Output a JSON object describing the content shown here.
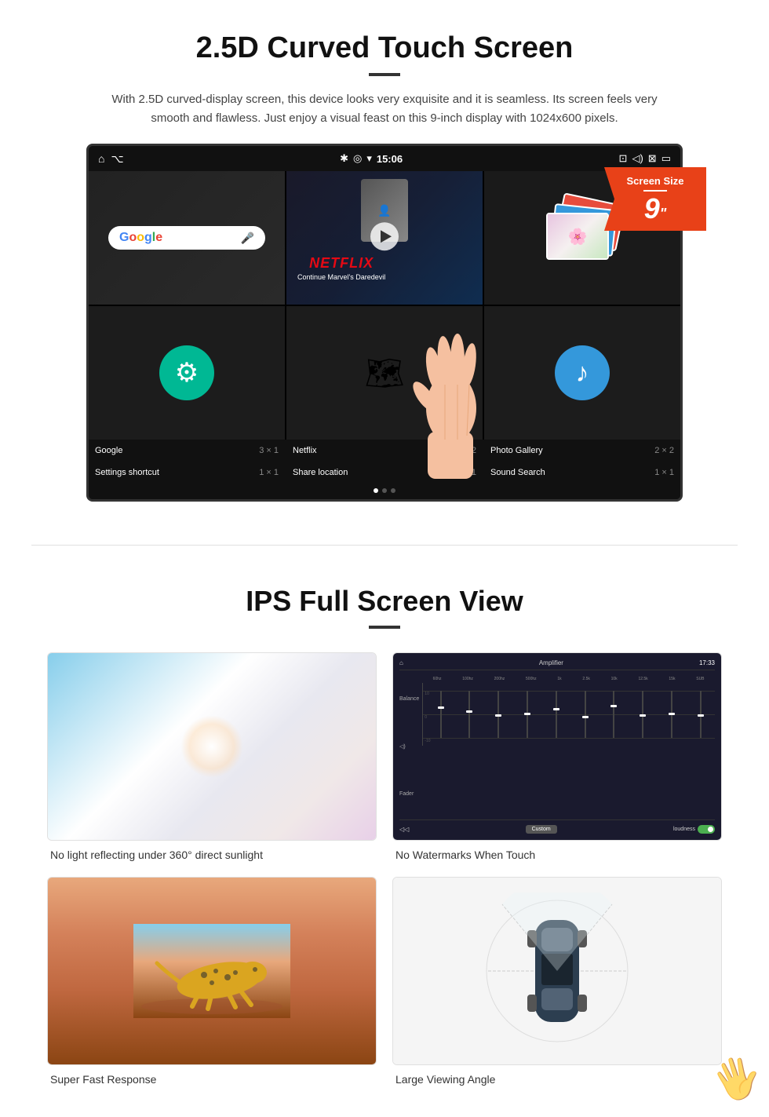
{
  "section1": {
    "title": "2.5D Curved Touch Screen",
    "description": "With 2.5D curved-display screen, this device looks very exquisite and it is seamless. Its screen feels very smooth and flawless. Just enjoy a visual feast on this 9-inch display with 1024x600 pixels.",
    "badge": {
      "label": "Screen Size",
      "size": "9",
      "inch": "\""
    },
    "status_bar": {
      "time": "15:06",
      "icons_left": [
        "home",
        "usb"
      ],
      "icons_right": [
        "bluetooth",
        "location",
        "wifi",
        "camera",
        "volume",
        "close",
        "screen"
      ]
    },
    "apps": [
      {
        "name": "Google",
        "size": "3 × 1"
      },
      {
        "name": "Netflix",
        "size": "3 × 2"
      },
      {
        "name": "Photo Gallery",
        "size": "2 × 2"
      },
      {
        "name": "Settings shortcut",
        "size": "1 × 1"
      },
      {
        "name": "Share location",
        "size": "1 × 1"
      },
      {
        "name": "Sound Search",
        "size": "1 × 1"
      }
    ],
    "netflix_text": "NETFLIX",
    "netflix_subtitle": "Continue Marvel's Daredevil"
  },
  "section2": {
    "title": "IPS Full Screen View",
    "features": [
      {
        "label": "No light reflecting under 360° direct sunlight",
        "image_type": "sky"
      },
      {
        "label": "No Watermarks When Touch",
        "image_type": "amplifier"
      },
      {
        "label": "Super Fast Response",
        "image_type": "cheetah"
      },
      {
        "label": "Large Viewing Angle",
        "image_type": "car"
      }
    ],
    "amplifier": {
      "title": "Amplifier",
      "time": "17:33",
      "labels": [
        "Balance",
        "Fader"
      ],
      "freq_labels": [
        "60hz",
        "100hz",
        "200hz",
        "500hz",
        "1k",
        "2.5k",
        "10k",
        "12.5k",
        "15k",
        "SUB"
      ],
      "custom_label": "Custom",
      "loudness_label": "loudness"
    }
  }
}
